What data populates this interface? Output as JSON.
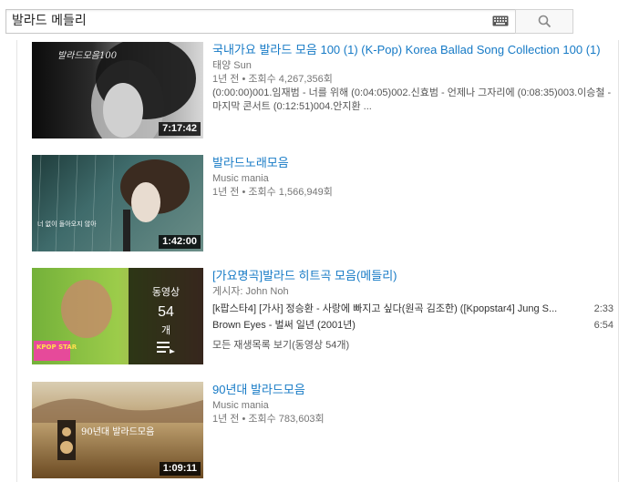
{
  "search": {
    "query": "발라드 메들리"
  },
  "results": [
    {
      "title": "국내가요 발라드 모음 100 (1) (K-Pop) Korea Ballad Song Collection 100 (1)",
      "channel": "태양 Sun",
      "meta": "1년 전 • 조회수 4,267,356회",
      "description": "(0:00:00)001.임재범 - 너를 위해 (0:04:05)002.신효범 - 언제나 그자리에 (0:08:35)003.이승철 - 마지막 콘서트 (0:12:51)004.안지환 ...",
      "duration": "7:17:42"
    },
    {
      "title": "발라드노래모음",
      "channel": "Music mania",
      "meta": "1년 전 • 조회수 1,566,949회",
      "duration": "1:42:00"
    },
    {
      "title": "[가요명곡]발라드 히트곡 모음(메들리)",
      "channel": "게시자: John Noh",
      "playlist_label": "동영상",
      "playlist_count": "54",
      "playlist_unit": "개",
      "playlist_items": [
        {
          "title": "[k팝스타4] [가사] 정승환 - 사랑에 빠지고 싶다(원곡 김조한) ([Kpopstar4] Jung S...",
          "duration": "2:33"
        },
        {
          "title": "Brown Eyes - 벌써 일년 (2001년)",
          "duration": "6:54"
        }
      ],
      "view_all": "모든 재생목록 보기(동영상 54개)"
    },
    {
      "title": "90년대 발라드모음",
      "channel": "Music mania",
      "meta": "1년 전 • 조회수 783,603회",
      "duration": "1:09:11"
    }
  ],
  "thumb_texts": {
    "t1": "발라드모음100",
    "t2": "너 없이 돌아오지 않아",
    "t3": "KPOP STAR",
    "t4": "90년대 발라드모음"
  },
  "colors": {
    "link": "#167ac6",
    "meta": "#767676"
  }
}
